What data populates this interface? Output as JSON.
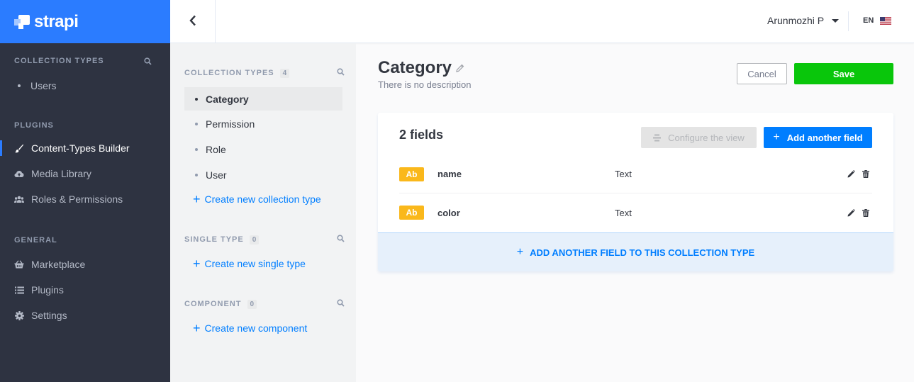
{
  "brand": {
    "name": "strapi"
  },
  "leftnav": {
    "collection_types": {
      "title": "COLLECTION TYPES",
      "items": [
        {
          "label": "Users",
          "icon": "dot"
        }
      ]
    },
    "plugins": {
      "title": "PLUGINS",
      "items": [
        {
          "label": "Content-Types Builder",
          "icon": "paint-brush-icon",
          "active": true
        },
        {
          "label": "Media Library",
          "icon": "cloud-upload-icon"
        },
        {
          "label": "Roles & Permissions",
          "icon": "users-icon"
        }
      ]
    },
    "general": {
      "title": "GENERAL",
      "items": [
        {
          "label": "Marketplace",
          "icon": "shopping-basket-icon"
        },
        {
          "label": "Plugins",
          "icon": "list-icon"
        },
        {
          "label": "Settings",
          "icon": "gear-icon"
        }
      ]
    }
  },
  "header": {
    "user": "Arunmozhi P",
    "language": "EN"
  },
  "subnav": {
    "collection_types": {
      "title": "COLLECTION TYPES",
      "count": "4",
      "items": [
        {
          "label": "Category",
          "active": true
        },
        {
          "label": "Permission"
        },
        {
          "label": "Role"
        },
        {
          "label": "User"
        }
      ],
      "create_label": "Create new collection type"
    },
    "single_type": {
      "title": "SINGLE TYPE",
      "count": "0",
      "create_label": "Create new single type"
    },
    "component": {
      "title": "COMPONENT",
      "count": "0",
      "create_label": "Create new component"
    }
  },
  "main": {
    "title": "Category",
    "description": "There is no description",
    "cancel_label": "Cancel",
    "save_label": "Save",
    "fields_count": "2 fields",
    "configure_label": "Configure the view",
    "add_field_label": "Add another field",
    "fields": [
      {
        "badge": "Ab",
        "name": "name",
        "type": "Text"
      },
      {
        "badge": "Ab",
        "name": "color",
        "type": "Text"
      }
    ],
    "add_bottom_label": "ADD ANOTHER FIELD TO THIS COLLECTION TYPE"
  },
  "colors": {
    "brand_blue": "#2b7cff",
    "link_blue": "#007eff",
    "save_green": "#09c60b",
    "badge_yellow": "#fab81b",
    "nav_dark": "#2e3341"
  }
}
